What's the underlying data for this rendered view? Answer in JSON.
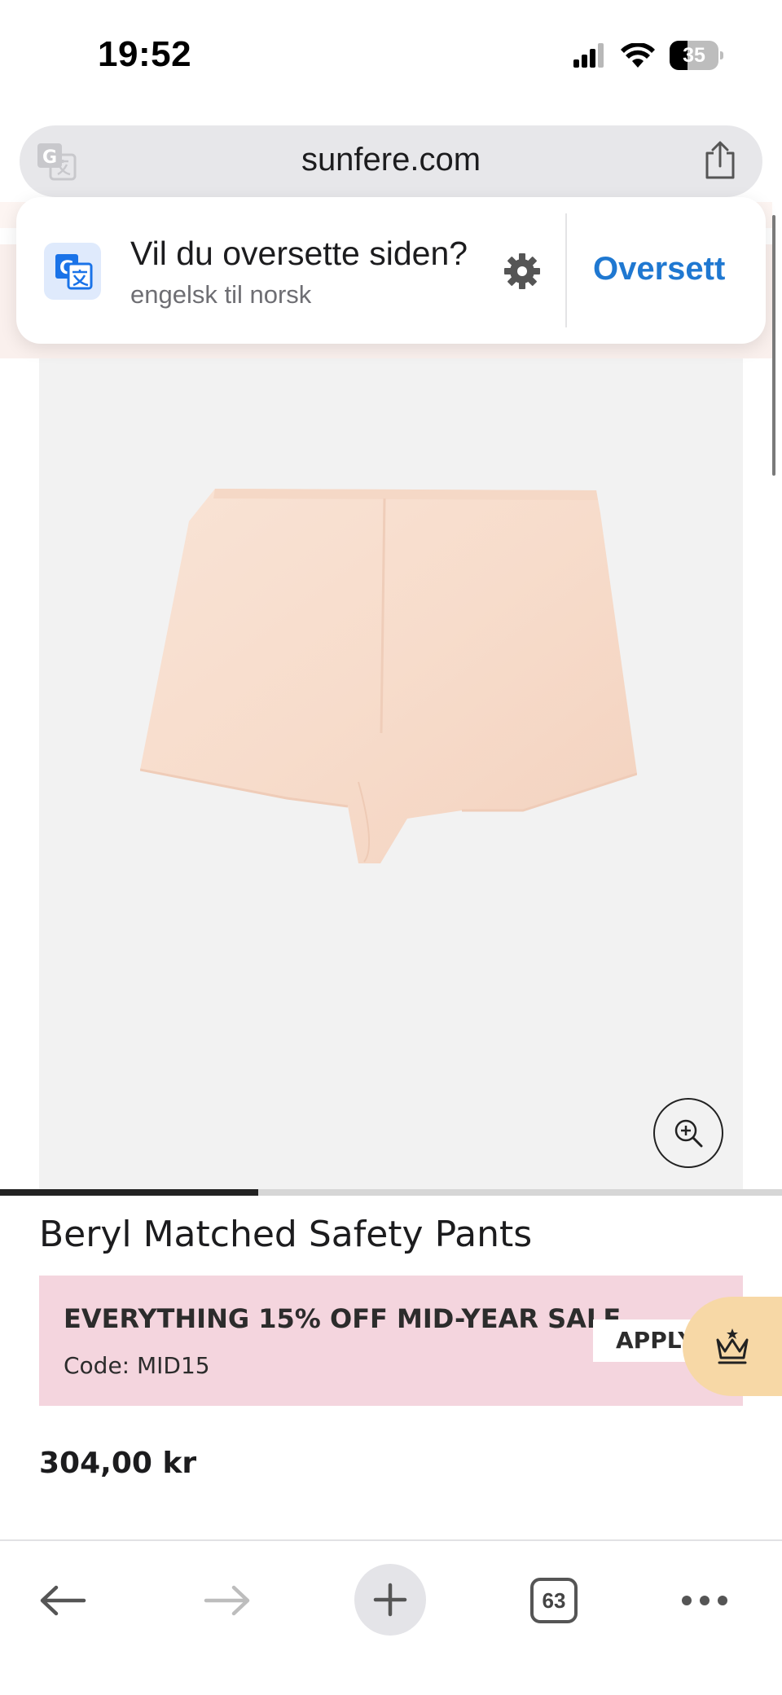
{
  "status_bar": {
    "time": "19:52",
    "battery": "35",
    "icons": [
      "cellular-signal-icon",
      "wifi-icon",
      "battery-icon"
    ]
  },
  "address_bar": {
    "url": "sunfere.com",
    "icons": [
      "translate-icon",
      "share-icon"
    ]
  },
  "translate_popup": {
    "title": "Vil du oversette siden?",
    "subtitle": "engelsk til norsk",
    "action": "Oversett",
    "accent": "#1f78d1"
  },
  "product": {
    "title": "Beryl Matched Safety Pants",
    "price": "304,00 kr",
    "image_progress": 0.33,
    "image_background": "#f2f2f2",
    "item_color": "#f7dccb"
  },
  "promo": {
    "headline": "EVERYTHING 15% OFF MID-YEAR SALE",
    "code": "Code: MID15",
    "apply": "APPLY",
    "background": "#f4d5de"
  },
  "crown_button": {
    "icon": "crown-icon",
    "background": "#f7d8a6"
  },
  "toolbar": {
    "tab_count": "63",
    "icons": [
      "back-arrow-icon",
      "forward-arrow-icon",
      "plus-icon",
      "tabs-icon",
      "more-icon"
    ]
  }
}
